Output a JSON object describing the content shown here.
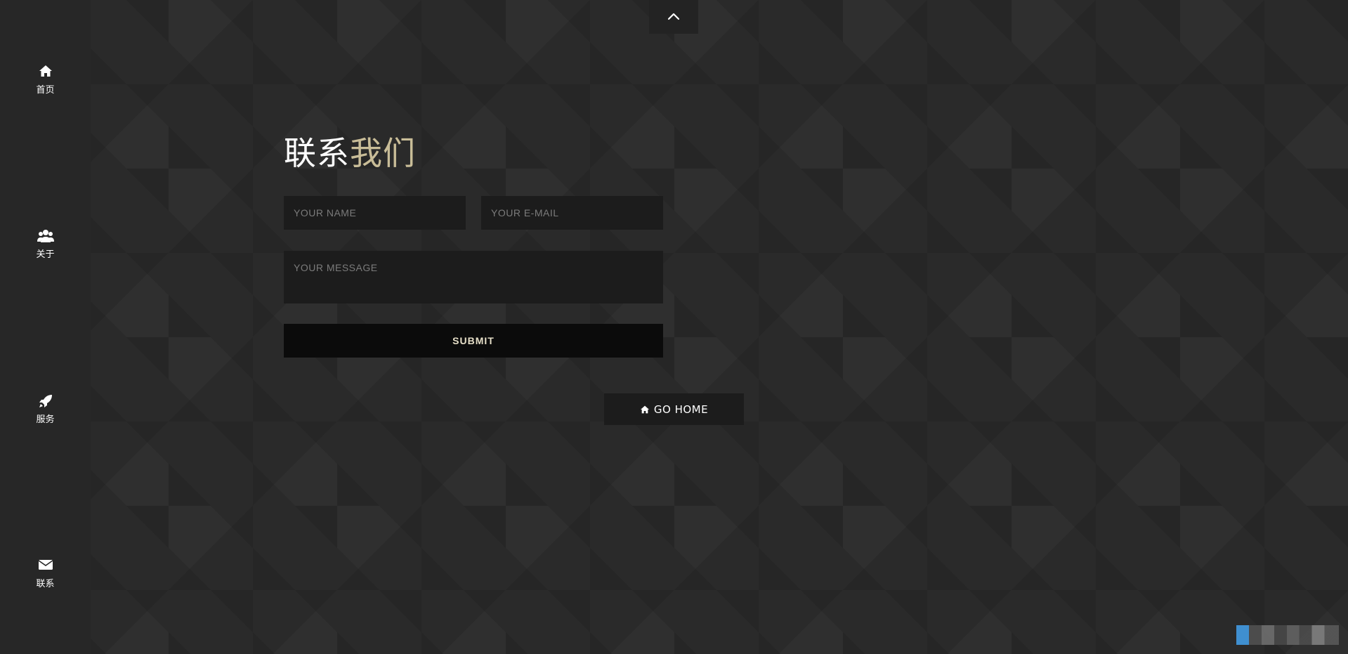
{
  "sidebar": {
    "items": [
      {
        "label": "首页",
        "icon": "home-icon"
      },
      {
        "label": "关于",
        "icon": "users-icon"
      },
      {
        "label": "服务",
        "icon": "rocket-icon"
      },
      {
        "label": "联系",
        "icon": "envelope-icon"
      }
    ]
  },
  "scroll_top": {
    "icon": "chevron-up-icon"
  },
  "contact": {
    "title_part1": "联系",
    "title_part2": "我们",
    "name_placeholder": "YOUR NAME",
    "email_placeholder": "YOUR E-MAIL",
    "message_placeholder": "YOUR MESSAGE",
    "submit_label": "SUBMIT"
  },
  "go_home": {
    "label": "GO HOME",
    "icon": "home-icon"
  },
  "colors": {
    "background": "#2a2a2a",
    "sidebar": "#272727",
    "accent_gold": "#c9bd98",
    "input_bg": "#1c1c1c",
    "submit_bg": "#0b0b0b",
    "badge_blue": "#3f8fd0"
  }
}
